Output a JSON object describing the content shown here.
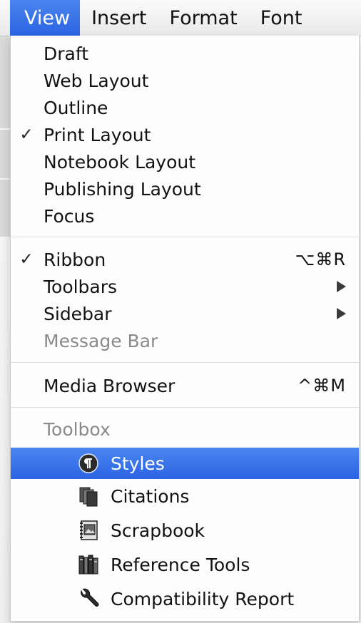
{
  "menubar": {
    "items": [
      {
        "label": "View",
        "active": true
      },
      {
        "label": "Insert"
      },
      {
        "label": "Format"
      },
      {
        "label": "Font"
      }
    ]
  },
  "view_menu": {
    "layout_items": [
      {
        "label": "Draft",
        "checked": false
      },
      {
        "label": "Web Layout",
        "checked": false
      },
      {
        "label": "Outline",
        "checked": false
      },
      {
        "label": "Print Layout",
        "checked": true
      },
      {
        "label": "Notebook Layout",
        "checked": false
      },
      {
        "label": "Publishing Layout",
        "checked": false
      },
      {
        "label": "Focus",
        "checked": false
      }
    ],
    "bar_items": [
      {
        "label": "Ribbon",
        "checked": true,
        "shortcut": "⌥⌘R"
      },
      {
        "label": "Toolbars",
        "submenu": true
      },
      {
        "label": "Sidebar",
        "submenu": true
      },
      {
        "label": "Message Bar",
        "disabled": true
      }
    ],
    "media_browser": {
      "label": "Media Browser",
      "shortcut": "^⌘M"
    },
    "toolbox": {
      "header": "Toolbox",
      "items": [
        {
          "label": "Styles",
          "icon": "styles-icon",
          "highlighted": true
        },
        {
          "label": "Citations",
          "icon": "citations-icon"
        },
        {
          "label": "Scrapbook",
          "icon": "scrapbook-icon"
        },
        {
          "label": "Reference Tools",
          "icon": "reference-tools-icon"
        },
        {
          "label": "Compatibility Report",
          "icon": "wrench-icon"
        }
      ]
    },
    "checkmark_glyph": "✓",
    "highlight_color": "#2f68e5"
  }
}
